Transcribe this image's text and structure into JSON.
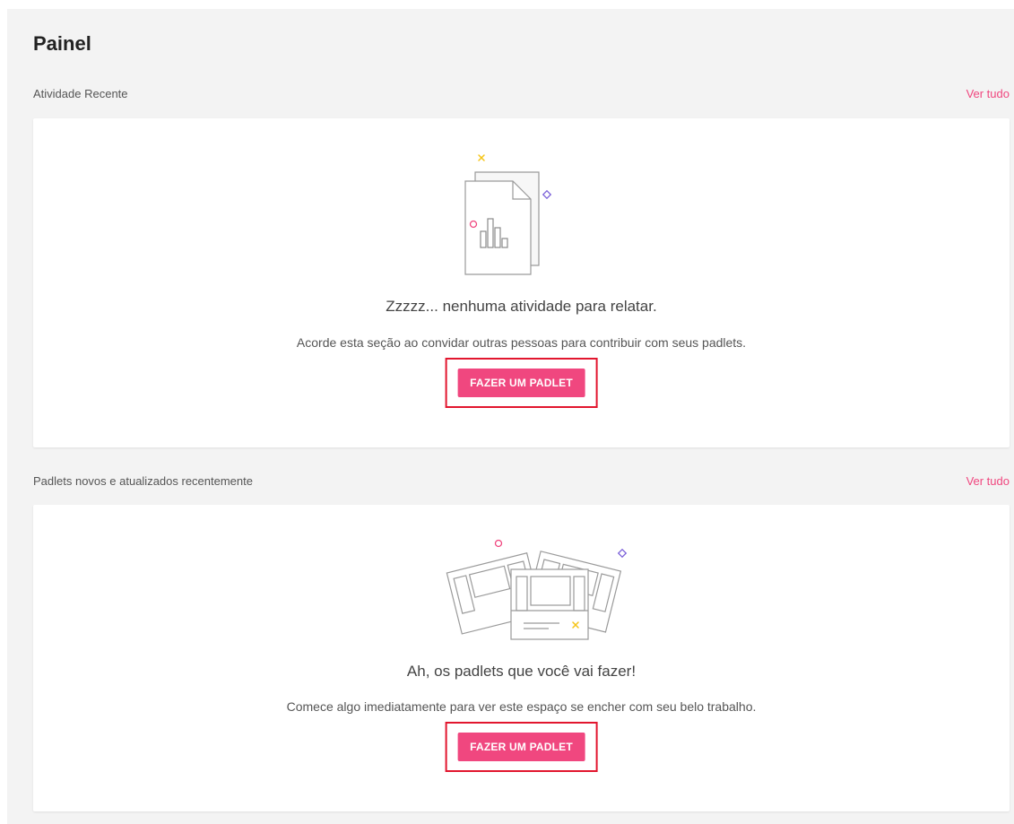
{
  "page": {
    "title": "Painel"
  },
  "sections": [
    {
      "label": "Atividade Recente",
      "see_all": "Ver tudo",
      "empty_headline": "Zzzzz... nenhuma atividade para relatar.",
      "empty_text": "Acorde esta seção ao convidar outras pessoas para contribuir com seus padlets.",
      "button": "FAZER UM PADLET",
      "illustration_icon": "document-chart-icon"
    },
    {
      "label": "Padlets novos e atualizados recentemente",
      "see_all": "Ver tudo",
      "empty_headline": "Ah, os padlets que você vai fazer!",
      "empty_text": "Comece algo imediatamente para ver este espaço se encher com seu belo trabalho.",
      "button": "FAZER UM PADLET",
      "illustration_icon": "padlet-boards-icon"
    }
  ],
  "colors": {
    "accent": "#f0477f",
    "highlight_border": "#e2162e",
    "background": "#f3f3f3",
    "card": "#ffffff"
  }
}
